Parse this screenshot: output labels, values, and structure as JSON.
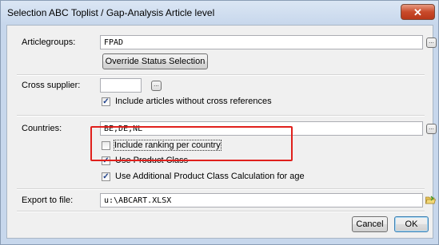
{
  "window": {
    "title": "Selection ABC Toplist / Gap-Analysis Article level",
    "close_label": "✕"
  },
  "articlegroups": {
    "label": "Articlegroups:",
    "value": "FPAD",
    "override_button": "Override Status Selection"
  },
  "cross_supplier": {
    "label": "Cross supplier:",
    "value": "",
    "include_without_refs": {
      "label": "Include articles without cross references",
      "checked": true
    }
  },
  "countries": {
    "label": "Countries:",
    "value": "BE,DE,NL",
    "include_ranking": {
      "label": "Include ranking per country",
      "checked": false
    },
    "use_product_class": {
      "label": "Use Product Class",
      "checked": true
    },
    "use_additional": {
      "label": "Use Additional Product Class Calculation for age",
      "checked": true
    }
  },
  "export": {
    "label": "Export to file:",
    "value": "u:\\ABCART.XLSX"
  },
  "buttons": {
    "cancel": "Cancel",
    "ok": "OK"
  },
  "icons": {
    "browse": "ellipsis-icon",
    "folder": "open-folder-icon"
  },
  "colors": {
    "highlight": "#e0201c",
    "check": "#1c3f8a"
  }
}
